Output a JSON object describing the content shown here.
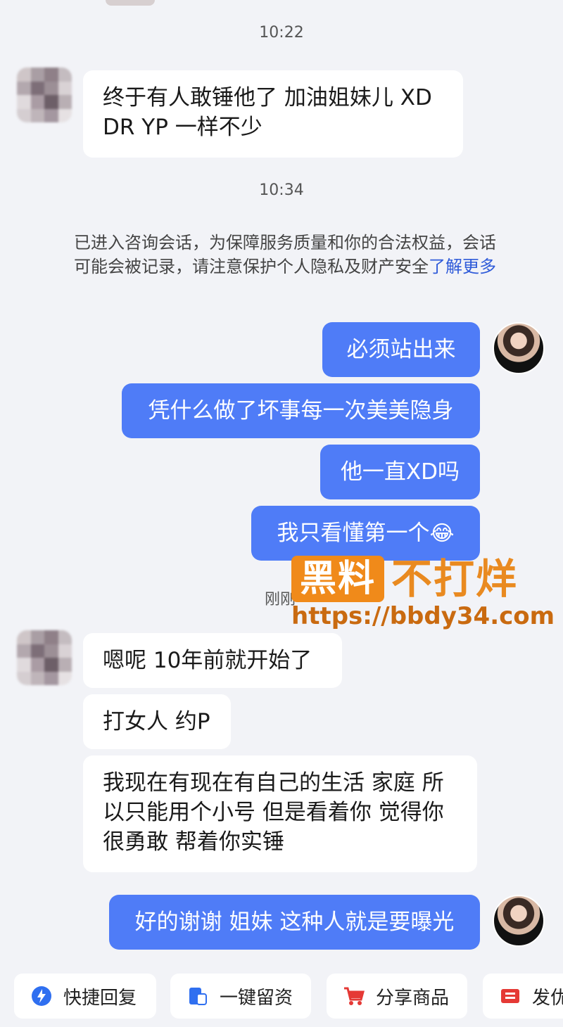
{
  "messages": {
    "time1": "10:22",
    "in1": "终于有人敢锤他了 加油姐妹儿 XD DR YP 一样不少",
    "time2": "10:34",
    "notice_text": "已进入咨询会话，为保障服务质量和你的合法权益，会话可能会被记录，请注意保护个人隐私及财产安全",
    "notice_link": "了解更多",
    "out1": "必须站出来",
    "out2": "凭什么做了坏事每一次美美隐身",
    "out3": "他一直XD吗",
    "out4": "我只看懂第一个",
    "out4_emoji": "😂",
    "time3": "刚刚",
    "in2": "嗯呢 10年前就开始了",
    "in3": "打女人 约P",
    "in4": "我现在有现在有自己的生活 家庭 所以只能用个小号 但是看着你 觉得你很勇敢 帮着你实锤",
    "out5": "好的谢谢 姐妹 这种人就是要曝光"
  },
  "watermark": {
    "box_text": "黑料",
    "text": "不打烊",
    "url": "https://bbdy34.com"
  },
  "toolbar": {
    "items": [
      {
        "label": "快捷回复",
        "icon": "lightning-icon"
      },
      {
        "label": "一键留资",
        "icon": "form-icon"
      },
      {
        "label": "分享商品",
        "icon": "cart-icon"
      },
      {
        "label": "发优",
        "icon": "coupon-icon"
      }
    ]
  },
  "colors": {
    "outgoing_bubble": "#4f7cf7",
    "incoming_bubble": "#ffffff",
    "background": "#f2f3f7",
    "link": "#2f5bd9",
    "watermark": "#f08a1a"
  }
}
